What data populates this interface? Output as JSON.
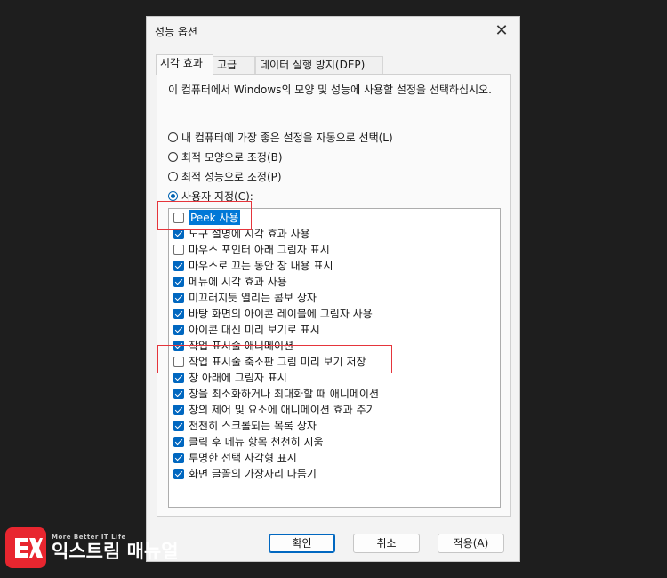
{
  "dialog": {
    "title": "성능 옵션",
    "close_glyph": "✕",
    "tabs": [
      "시각 효과",
      "고급",
      "데이터 실행 방지(DEP)"
    ],
    "description": "이 컴퓨터에서 Windows의 모양 및 성능에 사용할 설정을 선택하십시오.",
    "radios": [
      {
        "label": "내 컴퓨터에 가장 좋은 설정을 자동으로 선택(L)",
        "selected": false
      },
      {
        "label": "최적 모양으로 조정(B)",
        "selected": false
      },
      {
        "label": "최적 성능으로 조정(P)",
        "selected": false
      },
      {
        "label": "사용자 지정(C):",
        "selected": true
      }
    ],
    "checkboxes": [
      {
        "label": "Peek 사용",
        "checked": false
      },
      {
        "label": "도구 설명에 시각 효과 사용",
        "checked": true
      },
      {
        "label": "마우스 포인터 아래 그림자 표시",
        "checked": false
      },
      {
        "label": "마우스로 끄는 동안 창 내용 표시",
        "checked": true
      },
      {
        "label": "메뉴에 시각 효과 사용",
        "checked": true
      },
      {
        "label": "미끄러지듯 열리는 콤보 상자",
        "checked": true
      },
      {
        "label": "바탕 화면의 아이콘 레이블에 그림자 사용",
        "checked": true
      },
      {
        "label": "아이콘 대신 미리 보기로 표시",
        "checked": true
      },
      {
        "label": "작업 표시줄 애니메이션",
        "checked": true
      },
      {
        "label": "작업 표시줄 축소판 그림 미리 보기 저장",
        "checked": false
      },
      {
        "label": "창 아래에 그림자 표시",
        "checked": true
      },
      {
        "label": "창을 최소화하거나 최대화할 때 애니메이션",
        "checked": true
      },
      {
        "label": "창의 제어 및 요소에 애니메이션 효과 주기",
        "checked": true
      },
      {
        "label": "천천히 스크롤되는 목록 상자",
        "checked": true
      },
      {
        "label": "클릭 후 메뉴 항목 천천히 지움",
        "checked": true
      },
      {
        "label": "투명한 선택 사각형 표시",
        "checked": true
      },
      {
        "label": "화면 글꼴의 가장자리 다듬기",
        "checked": true
      }
    ],
    "buttons": {
      "ok": "확인",
      "cancel": "취소",
      "apply": "적용(A)"
    }
  },
  "watermark": {
    "tagline": "More Better IT Life",
    "name": "익스트림 매뉴얼"
  },
  "colors": {
    "accent": "#0067c0",
    "highlight_box": "#e5353b",
    "logo": "#e8262f"
  }
}
